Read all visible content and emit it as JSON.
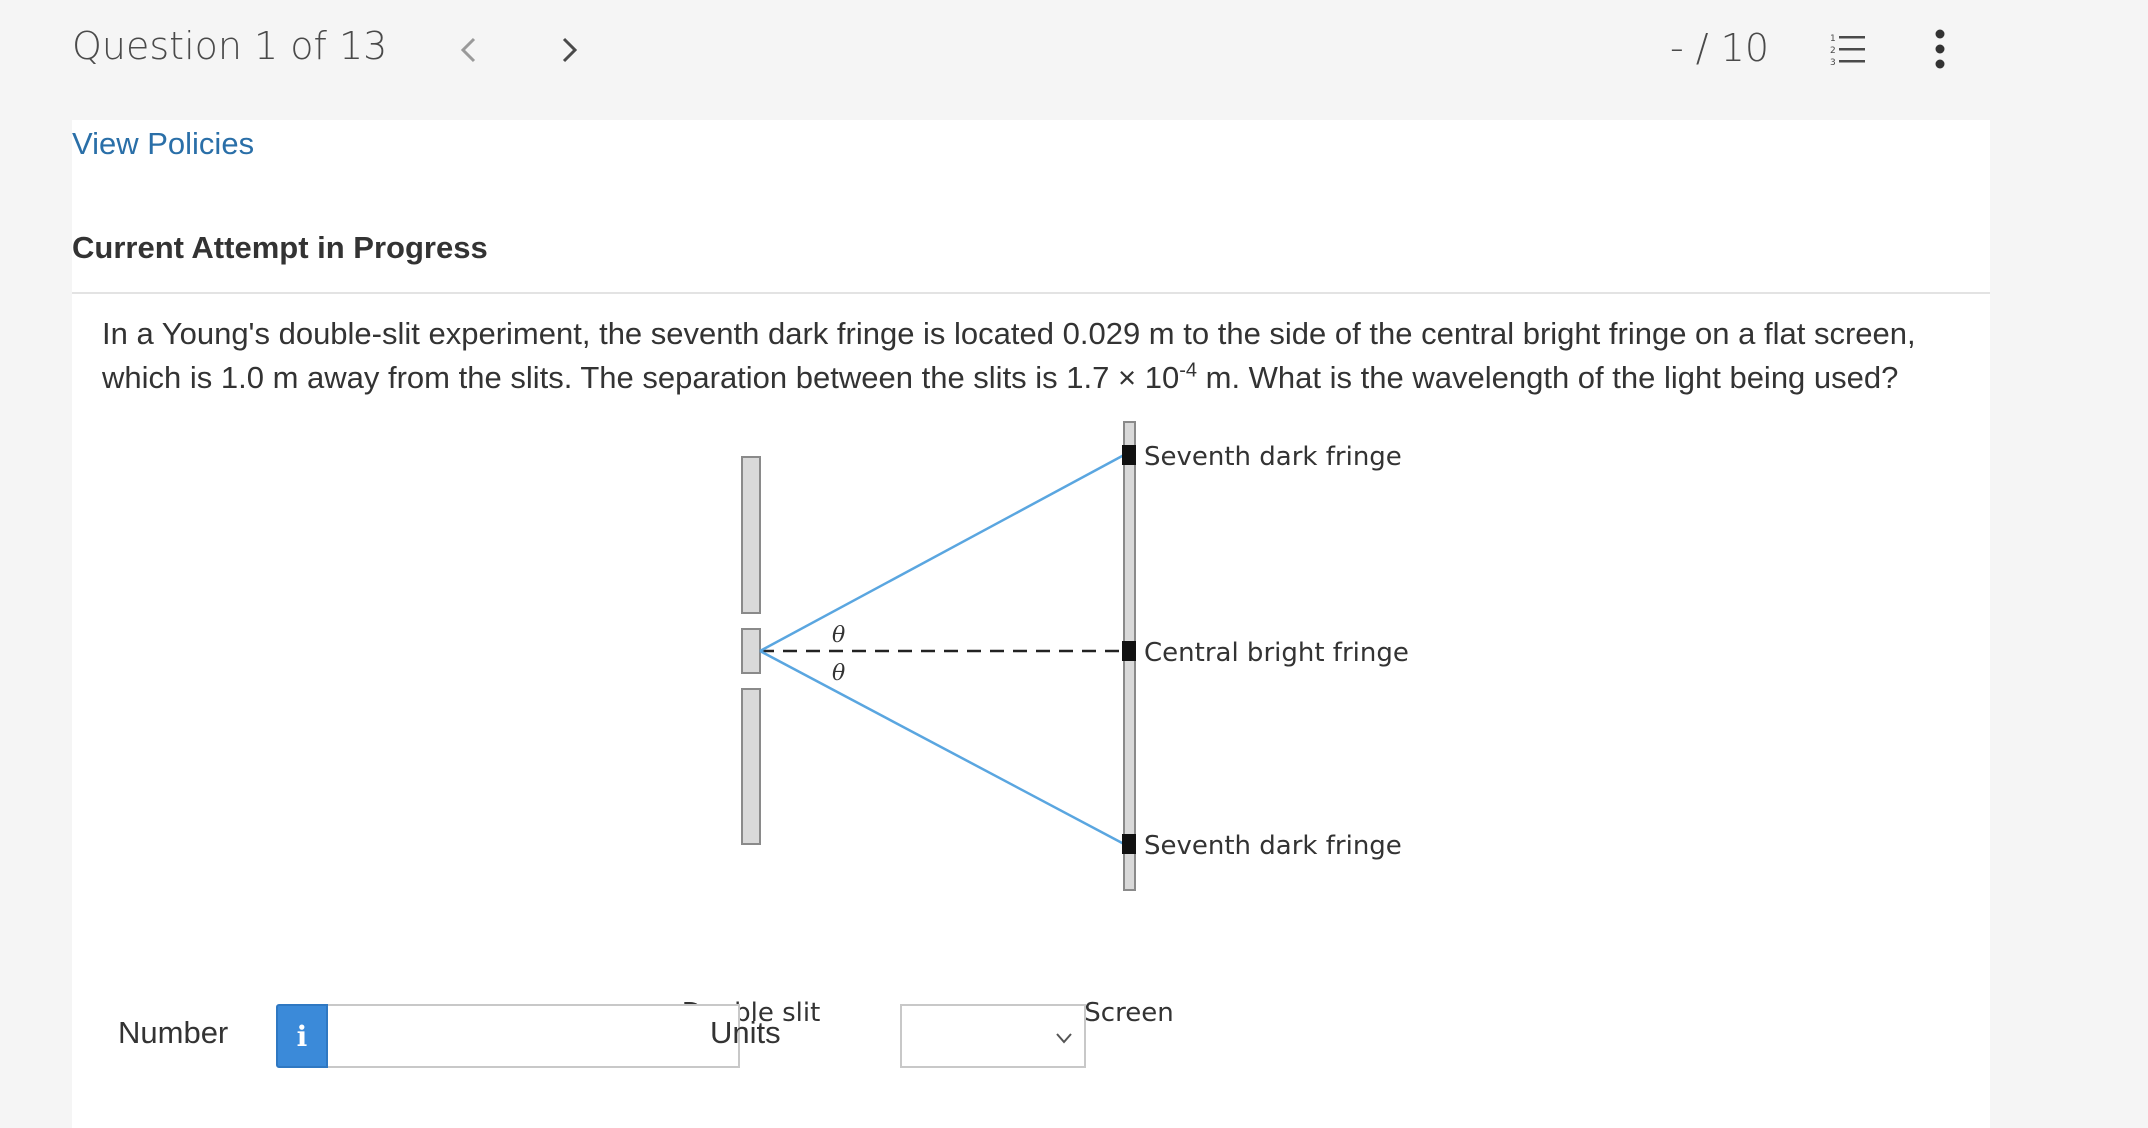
{
  "header": {
    "question_counter": "Question 1 of 13",
    "score": "- / 10"
  },
  "links": {
    "view_policies": "View Policies"
  },
  "attempt_heading": "Current Attempt in Progress",
  "question": {
    "text_part1": "In a Young's double-slit experiment, the seventh dark fringe is located 0.029 m to the side of the central bright fringe on a flat screen, which is 1.0 m away from the slits. The separation between the slits is 1.7 × 10",
    "exponent": "-4",
    "text_part2": " m. What is the wavelength of the light being used?"
  },
  "diagram": {
    "label_top": "Seventh dark fringe",
    "label_center": "Central bright fringe",
    "label_bottom": "Seventh dark fringe",
    "label_slit": "Double slit",
    "label_screen": "Screen",
    "angle_symbol": "θ",
    "ray_color": "#5aa6e0"
  },
  "answer": {
    "number_label": "Number",
    "info_icon": "i",
    "number_value": "",
    "units_label": "Units",
    "units_selected": ""
  },
  "icons": {
    "prev": "chevron-left-icon",
    "next": "chevron-right-icon",
    "list": "numbered-list-icon",
    "more": "more-vertical-icon"
  },
  "colors": {
    "accent_link": "#2a6fa8",
    "info_button": "#3b8ad9"
  }
}
